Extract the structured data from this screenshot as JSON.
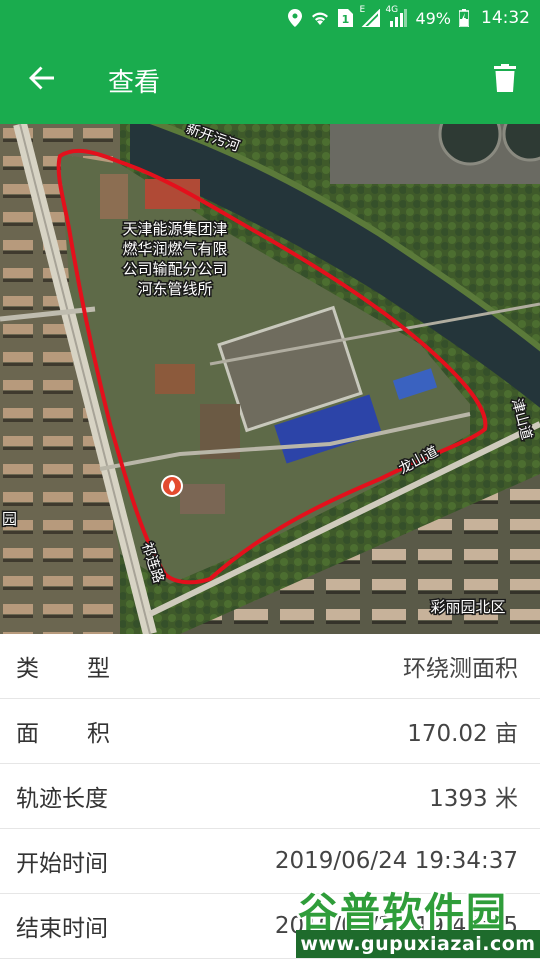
{
  "status_bar": {
    "battery_percent": "49%",
    "time": "14:32",
    "network_e": "E",
    "network_4g": "4G",
    "icons": [
      "location-icon",
      "wifi-icon",
      "sim1-icon",
      "signal-icon",
      "battery-icon"
    ]
  },
  "app_bar": {
    "title": "查看",
    "back_icon": "arrow-left-icon",
    "delete_icon": "trash-icon"
  },
  "map": {
    "labels": {
      "canal": "新开污河",
      "company_line1": "天津能源集团津",
      "company_line2": "燃华润燃气有限",
      "company_line3": "公司输配分公司",
      "company_line4": "河东管线所",
      "road_right": "津山道",
      "road_mid": "龙山道",
      "road_left": "祁连路",
      "district": "彩丽园北区",
      "left_edge": "园"
    },
    "track_color": "#e3101c"
  },
  "details": {
    "type_label": "类型",
    "type_value": "环绕测面积",
    "area_label": "面积",
    "area_value": "170.02 亩",
    "length_label": "轨迹长度",
    "length_value": "1393 米",
    "start_label": "开始时间",
    "start_value": "2019/06/24 19:34:37",
    "end_label": "结束时间",
    "end_value": "2019/06/24 19:47:55"
  },
  "watermark": {
    "main": "谷普软件园",
    "url": "www.gupuxiazai.com"
  }
}
